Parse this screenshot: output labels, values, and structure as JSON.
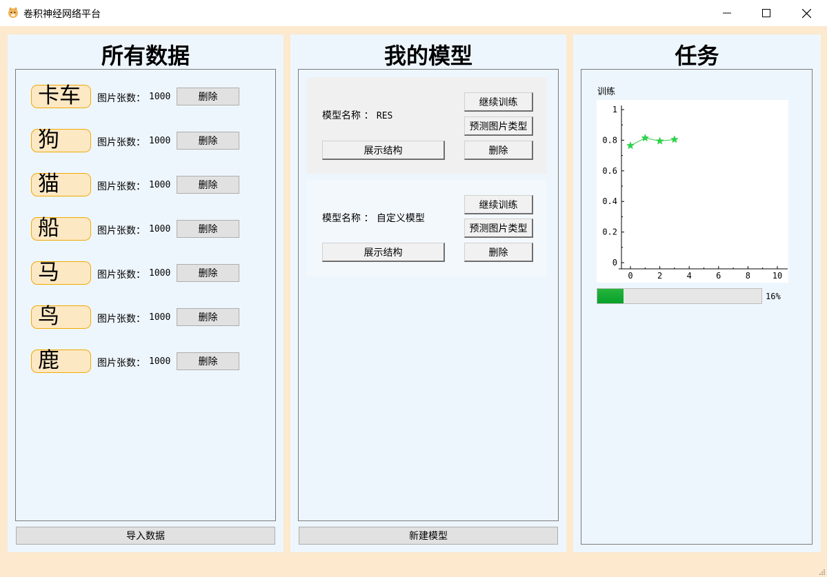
{
  "window": {
    "title": "卷积神经网络平台"
  },
  "data_panel": {
    "title": "所有数据",
    "image_count_label": "图片张数：",
    "delete_label": "删除",
    "import_label": "导入数据",
    "items": [
      {
        "name": "卡车",
        "count": "1000"
      },
      {
        "name": "狗",
        "count": "1000"
      },
      {
        "name": "猫",
        "count": "1000"
      },
      {
        "name": "船",
        "count": "1000"
      },
      {
        "name": "马",
        "count": "1000"
      },
      {
        "name": "鸟",
        "count": "1000"
      },
      {
        "name": "鹿",
        "count": "1000"
      }
    ]
  },
  "model_panel": {
    "title": "我的模型",
    "model_name_label": "模型名称 ：",
    "continue_train_label": "继续训练",
    "predict_label": "预测图片类型",
    "show_structure_label": "展示结构",
    "delete_label": "删除",
    "new_model_label": "新建模型",
    "models": [
      {
        "name": "RES"
      },
      {
        "name": "自定义模型"
      }
    ]
  },
  "task_panel": {
    "title": "任务",
    "progress_percent": 16,
    "progress_text": "16%",
    "chart_data": {
      "type": "line",
      "title": "训练",
      "xlabel": "",
      "ylabel": "",
      "x_ticks": [
        "0",
        "2",
        "4",
        "6",
        "8",
        "10"
      ],
      "y_ticks": [
        "0",
        "0.2",
        "0.4",
        "0.6",
        "0.8",
        "1"
      ],
      "xlim": [
        0,
        10
      ],
      "ylim": [
        0,
        1
      ],
      "marker": "star",
      "series": [
        {
          "x": [
            0,
            1,
            2,
            3
          ],
          "y": [
            0.76,
            0.81,
            0.79,
            0.8
          ]
        }
      ],
      "colors": {
        "line": "#33cc44",
        "marker": "#22dd44"
      }
    }
  }
}
